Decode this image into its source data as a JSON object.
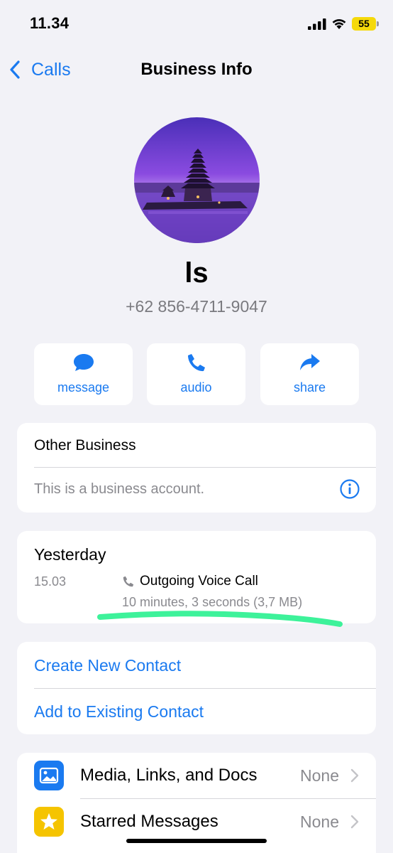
{
  "status_bar": {
    "time": "11.34",
    "battery": "55"
  },
  "nav": {
    "back_label": "Calls",
    "title": "Business Info"
  },
  "contact": {
    "name": "ls",
    "phone": "+62 856-4711-9047"
  },
  "actions": [
    {
      "label": "message",
      "icon": "message-bubble-icon"
    },
    {
      "label": "audio",
      "icon": "phone-icon"
    },
    {
      "label": "share",
      "icon": "share-arrow-icon"
    }
  ],
  "business": {
    "title": "Other Business",
    "description": "This is a business account."
  },
  "call_log": {
    "day": "Yesterday",
    "time": "15.03",
    "type": "Outgoing Voice Call",
    "detail": "10 minutes, 3 seconds (3,7 MB)"
  },
  "contact_actions": {
    "create": "Create New Contact",
    "add_existing": "Add to Existing Contact"
  },
  "media_rows": [
    {
      "label": "Media, Links, and Docs",
      "value": "None",
      "icon": "photo-icon"
    },
    {
      "label": "Starred Messages",
      "value": "None",
      "icon": "star-icon"
    }
  ],
  "colors": {
    "accent": "#1a7af0",
    "background": "#f2f2f7",
    "highlight": "#3df29a",
    "battery": "#f5d90a"
  }
}
